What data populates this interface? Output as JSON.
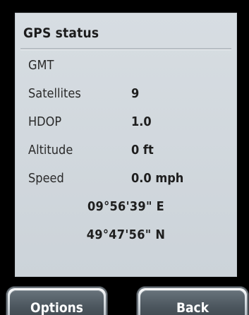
{
  "screen": {
    "title": "GPS status"
  },
  "rows": [
    {
      "label": "GMT",
      "value": ""
    },
    {
      "label": "Satellites",
      "value": "9"
    },
    {
      "label": "HDOP",
      "value": "1.0"
    },
    {
      "label": "Altitude",
      "value": "0 ft"
    },
    {
      "label": "Speed",
      "value": "0.0 mph"
    }
  ],
  "coordinates": {
    "longitude": "09°56'39\" E",
    "latitude": "49°47'56\" N"
  },
  "softkeys": {
    "left_label": "Options",
    "right_label": "Back"
  },
  "colors": {
    "panel_background": "#d2d9de",
    "softkey_face": "#4c565e",
    "text": "#1e1e1e"
  }
}
